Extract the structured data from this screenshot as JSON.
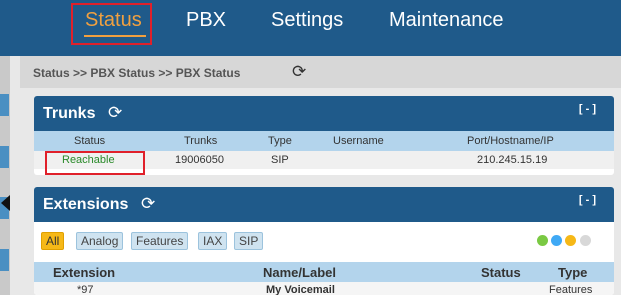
{
  "topnav": {
    "items": [
      "Status",
      "PBX",
      "Settings",
      "Maintenance"
    ],
    "active": "Status"
  },
  "breadcrumb": "Status >> PBX Status >> PBX Status",
  "trunks": {
    "title": "Trunks",
    "collapse": "[ - ]",
    "columns": [
      "Status",
      "Trunks",
      "Type",
      "Username",
      "Port/Hostname/IP"
    ],
    "rows": [
      {
        "status": "Reachable",
        "trunk": "19006050",
        "type": "SIP",
        "username": "",
        "host": "210.245.15.19"
      }
    ]
  },
  "extensions": {
    "title": "Extensions",
    "collapse": "[ - ]",
    "filters": [
      "All",
      "Analog",
      "Features",
      "IAX",
      "SIP"
    ],
    "active_filter": "All",
    "legend_colors": [
      "#7ac943",
      "#3fa9f5",
      "#f6b817",
      "#d8d8d8"
    ],
    "columns": [
      "Extension",
      "Name/Label",
      "Status",
      "Type"
    ],
    "rows": [
      {
        "extension": "*97",
        "name": "My Voicemail",
        "status": "",
        "type": "Features"
      }
    ]
  },
  "colors": {
    "nav_bg": "#1f5a8a",
    "active_nav": "#f0a040",
    "highlight": "#e0202a",
    "reachable": "#2a8a2a"
  }
}
